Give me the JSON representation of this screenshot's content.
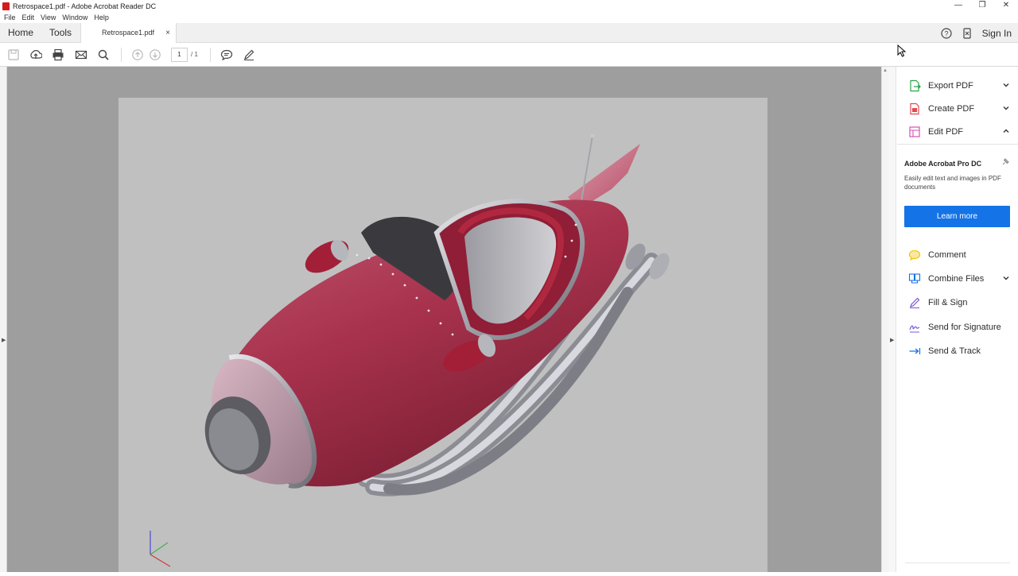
{
  "window": {
    "title": "Retrospace1.pdf - Adobe Acrobat Reader DC",
    "controls": {
      "minimize": "—",
      "restore": "❐",
      "close": "✕"
    }
  },
  "menu": [
    "File",
    "Edit",
    "View",
    "Window",
    "Help"
  ],
  "tabs": {
    "home": "Home",
    "tools": "Tools",
    "document": "Retrospace1.pdf",
    "close": "×"
  },
  "header_right": {
    "help_icon": "help-icon",
    "mobile_icon": "mobile-link-icon",
    "sign_in": "Sign In"
  },
  "toolbar": {
    "icons": [
      "save-icon",
      "upload-icon",
      "print-icon",
      "email-icon",
      "search-icon",
      "page-up-icon",
      "page-down-icon",
      "comment-icon",
      "pen-icon"
    ],
    "current_page": "1",
    "total_pages": "/ 1"
  },
  "right_panel": {
    "tools": [
      {
        "label": "Export PDF",
        "icon": "export-pdf-icon",
        "expanded": false,
        "color": "#2da44e"
      },
      {
        "label": "Create PDF",
        "icon": "create-pdf-icon",
        "expanded": false,
        "color": "#e34850"
      },
      {
        "label": "Edit PDF",
        "icon": "edit-pdf-icon",
        "expanded": true,
        "color": "#d74fb7"
      }
    ],
    "promo": {
      "title": "Adobe Acrobat Pro DC",
      "text": "Easily edit text and images in PDF documents",
      "button": "Learn more"
    },
    "more_tools": [
      {
        "label": "Comment",
        "icon": "comment-tool-icon",
        "color": "#f2c200"
      },
      {
        "label": "Combine Files",
        "icon": "combine-files-icon",
        "color": "#1473e6",
        "has_chevron": true
      },
      {
        "label": "Fill & Sign",
        "icon": "fill-sign-icon",
        "color": "#7c58d6"
      },
      {
        "label": "Send for Signature",
        "icon": "send-signature-icon",
        "color": "#7c58d6"
      },
      {
        "label": "Send & Track",
        "icon": "send-track-icon",
        "color": "#1473e6"
      }
    ]
  },
  "document": {
    "content": "3d-model",
    "subject": "retro rocket car",
    "colors": {
      "body": "#a8324d",
      "chrome": "#bfc0c6",
      "page_bg": "#c0c0c0",
      "canvas_bg": "#9e9e9e"
    }
  },
  "colors": {
    "accent": "#1473e6"
  }
}
